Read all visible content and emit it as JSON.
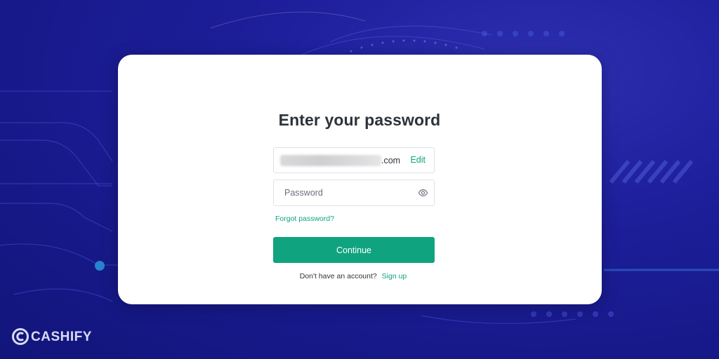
{
  "dialog": {
    "title": "Enter your password",
    "email_suffix": ".com",
    "edit_label": "Edit",
    "password_placeholder": "Password",
    "forgot_label": "Forgot password?",
    "continue_label": "Continue",
    "signup_prompt": "Don't have an account?",
    "signup_label": "Sign up"
  },
  "watermark": {
    "text": "CASHIFY"
  },
  "colors": {
    "accent": "#10a37f",
    "background": "#1d1f9c",
    "card": "#ffffff",
    "text": "#2d333a"
  }
}
